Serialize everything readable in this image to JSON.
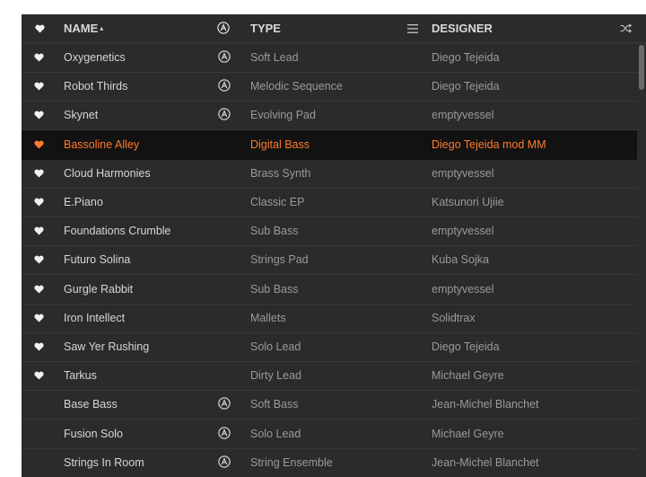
{
  "header": {
    "name_label": "NAME",
    "sort_indicator": "▴",
    "type_label": "TYPE",
    "designer_label": "DESIGNER",
    "icons": [
      "heart-icon",
      "arturia-icon",
      "filter-list-icon",
      "shuffle-icon"
    ]
  },
  "colors": {
    "background": "#2b2b2b",
    "selected_row_bg": "#121212",
    "accent": "#ff7a2a",
    "text_primary": "#d6d6d6",
    "text_secondary": "#9a9a9a"
  },
  "rows": [
    {
      "favorite": true,
      "name": "Oxygenetics",
      "factory": true,
      "type": "Soft Lead",
      "designer": "Diego Tejeida",
      "selected": false
    },
    {
      "favorite": true,
      "name": "Robot Thirds",
      "factory": true,
      "type": "Melodic Sequence",
      "designer": "Diego Tejeida",
      "selected": false
    },
    {
      "favorite": true,
      "name": "Skynet",
      "factory": true,
      "type": "Evolving Pad",
      "designer": "emptyvessel",
      "selected": false
    },
    {
      "favorite": true,
      "name": "Bassoline Alley",
      "factory": false,
      "type": "Digital Bass",
      "designer": "Diego Tejeida mod MM",
      "selected": true
    },
    {
      "favorite": true,
      "name": "Cloud Harmonies",
      "factory": false,
      "type": "Brass Synth",
      "designer": "emptyvessel",
      "selected": false
    },
    {
      "favorite": true,
      "name": "E.Piano",
      "factory": false,
      "type": "Classic EP",
      "designer": "Katsunori Ujiie",
      "selected": false
    },
    {
      "favorite": true,
      "name": "Foundations Crumble",
      "factory": false,
      "type": "Sub Bass",
      "designer": "emptyvessel",
      "selected": false
    },
    {
      "favorite": true,
      "name": "Futuro Solina",
      "factory": false,
      "type": "Strings Pad",
      "designer": "Kuba Sojka",
      "selected": false
    },
    {
      "favorite": true,
      "name": "Gurgle Rabbit",
      "factory": false,
      "type": "Sub Bass",
      "designer": "emptyvessel",
      "selected": false
    },
    {
      "favorite": true,
      "name": "Iron Intellect",
      "factory": false,
      "type": "Mallets",
      "designer": "Solidtrax",
      "selected": false
    },
    {
      "favorite": true,
      "name": "Saw Yer Rushing",
      "factory": false,
      "type": "Solo Lead",
      "designer": "Diego Tejeida",
      "selected": false
    },
    {
      "favorite": true,
      "name": "Tarkus",
      "factory": false,
      "type": "Dirty Lead",
      "designer": "Michael Geyre",
      "selected": false
    },
    {
      "favorite": false,
      "name": "Base Bass",
      "factory": true,
      "type": "Soft Bass",
      "designer": "Jean-Michel Blanchet",
      "selected": false
    },
    {
      "favorite": false,
      "name": "Fusion Solo",
      "factory": true,
      "type": "Solo Lead",
      "designer": "Michael Geyre",
      "selected": false
    },
    {
      "favorite": false,
      "name": "Strings In Room",
      "factory": true,
      "type": "String Ensemble",
      "designer": "Jean-Michel Blanchet",
      "selected": false
    }
  ]
}
